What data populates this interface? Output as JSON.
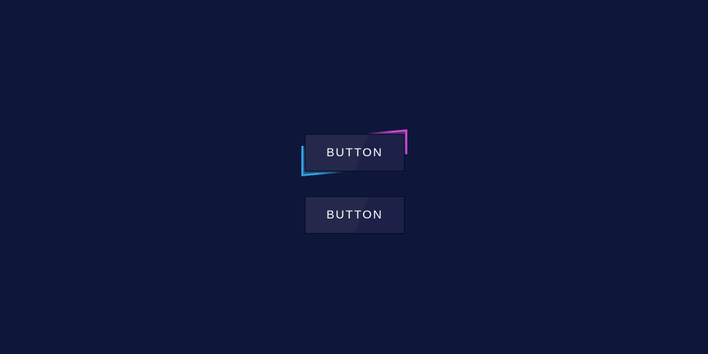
{
  "page": {
    "background_color": "#0e163a"
  },
  "buttons": [
    {
      "label": "BUTTON",
      "state": "hover",
      "glow_colors": {
        "top_right": "#d14fd6",
        "bottom_left": "#3aa9e8"
      }
    },
    {
      "label": "BUTTON",
      "state": "default"
    }
  ]
}
